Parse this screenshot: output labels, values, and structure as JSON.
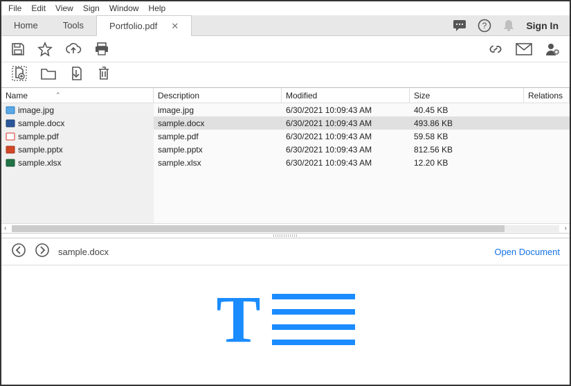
{
  "menu": {
    "items": [
      "File",
      "Edit",
      "View",
      "Sign",
      "Window",
      "Help"
    ]
  },
  "tabs": {
    "home": "Home",
    "tools": "Tools",
    "doc": "Portfolio.pdf"
  },
  "signin": "Sign In",
  "columns": {
    "name": "Name",
    "desc": "Description",
    "mod": "Modified",
    "size": "Size",
    "rel": "Relations"
  },
  "files": [
    {
      "name": "image.jpg",
      "desc": "image.jpg",
      "mod": "6/30/2021 10:09:43 AM",
      "size": "40.45 KB",
      "type": "img",
      "selected": false
    },
    {
      "name": "sample.docx",
      "desc": "sample.docx",
      "mod": "6/30/2021 10:09:43 AM",
      "size": "493.86 KB",
      "type": "docx",
      "selected": true
    },
    {
      "name": "sample.pdf",
      "desc": "sample.pdf",
      "mod": "6/30/2021 10:09:43 AM",
      "size": "59.58 KB",
      "type": "pdf",
      "selected": false
    },
    {
      "name": "sample.pptx",
      "desc": "sample.pptx",
      "mod": "6/30/2021 10:09:43 AM",
      "size": "812.56 KB",
      "type": "pptx",
      "selected": false
    },
    {
      "name": "sample.xlsx",
      "desc": "sample.xlsx",
      "mod": "6/30/2021 10:09:43 AM",
      "size": "12.20 KB",
      "type": "xlsx",
      "selected": false
    }
  ],
  "preview": {
    "title": "sample.docx",
    "open": "Open Document"
  },
  "icons": {
    "img": {
      "fill": "#5aa9e6",
      "stroke": "#2d7cc0"
    },
    "docx": {
      "fill": "#2b579a",
      "stroke": "#1e3f70"
    },
    "pdf": {
      "fill": "#ffffff",
      "stroke": "#d93025"
    },
    "pptx": {
      "fill": "#d24726",
      "stroke": "#a3371d"
    },
    "xlsx": {
      "fill": "#217346",
      "stroke": "#18552f"
    }
  }
}
